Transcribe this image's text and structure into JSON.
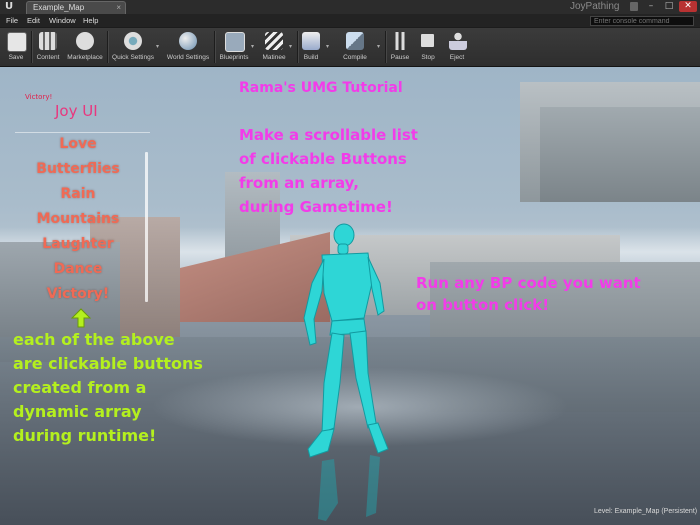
{
  "window": {
    "tab_title": "Example_Map",
    "project": "JoyPathing",
    "close_glyph": "×",
    "controls": {
      "minimize": "–",
      "maximize": "□",
      "close": "✕"
    }
  },
  "menu": [
    "File",
    "Edit",
    "Window",
    "Help"
  ],
  "console": {
    "placeholder": "Enter console command"
  },
  "toolbar": {
    "items": [
      {
        "label": "Save",
        "icon": "save-icon"
      },
      {
        "label": "Content",
        "icon": "content-browser-icon"
      },
      {
        "label": "Marketplace",
        "icon": "marketplace-icon"
      },
      {
        "label": "Quick Settings",
        "icon": "quick-settings-icon"
      },
      {
        "label": "World Settings",
        "icon": "world-settings-icon"
      },
      {
        "label": "Blueprints",
        "icon": "blueprints-icon"
      },
      {
        "label": "Matinee",
        "icon": "matinee-icon"
      },
      {
        "label": "Build",
        "icon": "build-icon"
      },
      {
        "label": "Compile",
        "icon": "compile-icon"
      },
      {
        "label": "Pause",
        "icon": "pause-icon"
      },
      {
        "label": "Stop",
        "icon": "stop-icon"
      },
      {
        "label": "Eject",
        "icon": "eject-icon"
      }
    ]
  },
  "hud": {
    "victory_small": "Victory!",
    "title": "Joy UI",
    "buttons": [
      "Love",
      "Butterflies",
      "Rain",
      "Mountains",
      "Laughter",
      "Dance",
      "Victory!"
    ],
    "tutorial_title": "Rama's UMG Tutorial",
    "description": [
      "Make a scrollable list",
      "of clickable Buttons",
      "from an array,",
      "during Gametime!"
    ],
    "bp_note": [
      "Run any BP code you want",
      "on button click!"
    ],
    "explanation": [
      "each of the above",
      "are clickable buttons",
      "created from a",
      "dynamic array",
      "during runtime!"
    ]
  },
  "status": {
    "level": "Level:  Example_Map (Persistent)"
  },
  "colors": {
    "magenta": "#f23ce9",
    "lime": "#b4f01e",
    "button_text": "#f06a55",
    "title_pink": "#e8377e"
  }
}
